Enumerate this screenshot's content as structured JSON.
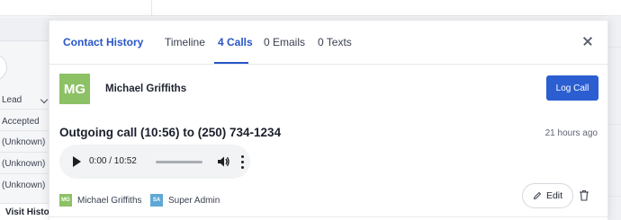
{
  "background": {
    "fields": [
      {
        "label": "Lead",
        "has_dropdown": true
      },
      {
        "label": "Accepted",
        "has_dropdown": false
      },
      {
        "label": "(Unknown)",
        "has_dropdown": false
      },
      {
        "label": "(Unknown)",
        "has_dropdown": false
      },
      {
        "label": "(Unknown)",
        "has_dropdown": false
      }
    ],
    "visit_tab": "Visit Histo"
  },
  "modal": {
    "title": "Contact History",
    "tabs": [
      {
        "label": "Timeline",
        "active": false
      },
      {
        "label": "4 Calls",
        "active": true
      },
      {
        "label": "0 Emails",
        "active": false
      },
      {
        "label": "0 Texts",
        "active": false
      }
    ],
    "close_icon": "close-icon"
  },
  "contact": {
    "initials": "MG",
    "name": "Michael Griffiths",
    "avatar_color": "#8dc165"
  },
  "actions": {
    "log_call": "Log Call",
    "log_call_color": "#2a5ed1"
  },
  "call": {
    "title": "Outgoing call (10:56) to (250) 734-1234",
    "time_ago": "21 hours ago",
    "audio": {
      "time": "0:00 / 10:52",
      "progress": 0
    },
    "participants": [
      {
        "initials": "MG",
        "name": "Michael Griffiths",
        "color": "#8dc165"
      },
      {
        "initials": "SA",
        "name": "Super Admin",
        "color": "#5fa8d6"
      }
    ],
    "edit_label": "Edit"
  },
  "colors": {
    "accent": "#2856c7",
    "primary_button": "#2a5ed1"
  }
}
